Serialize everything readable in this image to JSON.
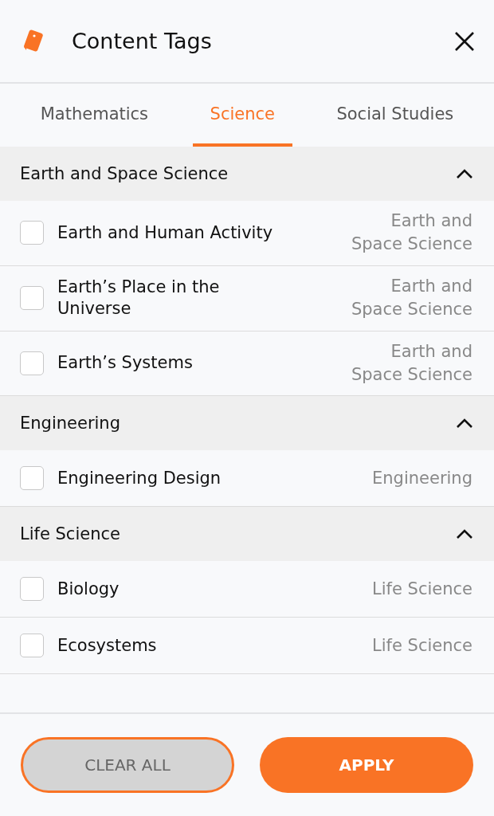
{
  "header": {
    "title": "Content Tags"
  },
  "tabs": [
    {
      "label": "Mathematics",
      "selected": false
    },
    {
      "label": "Science",
      "selected": true
    },
    {
      "label": "Social Studies",
      "selected": false
    }
  ],
  "groups": [
    {
      "title": "Earth and Space Science",
      "expanded": true,
      "items": [
        {
          "label": "Earth and Human Activity",
          "category": "Earth and Space Science",
          "checked": false
        },
        {
          "label": "Earth’s Place in the Universe",
          "category": "Earth and Space Science",
          "checked": false
        },
        {
          "label": "Earth’s Systems",
          "category": "Earth and Space Science",
          "checked": false
        }
      ]
    },
    {
      "title": "Engineering",
      "expanded": true,
      "items": [
        {
          "label": "Engineering Design",
          "category": "Engineering",
          "checked": false
        }
      ]
    },
    {
      "title": "Life Science",
      "expanded": true,
      "items": [
        {
          "label": "Biology",
          "category": "Life Science",
          "checked": false
        },
        {
          "label": "Ecosystems",
          "category": "Life Science",
          "checked": false
        }
      ]
    }
  ],
  "buttons": [
    {
      "label": "CLEAR ALL",
      "kind": "secondary"
    },
    {
      "label": "APPLY",
      "kind": "primary"
    }
  ]
}
